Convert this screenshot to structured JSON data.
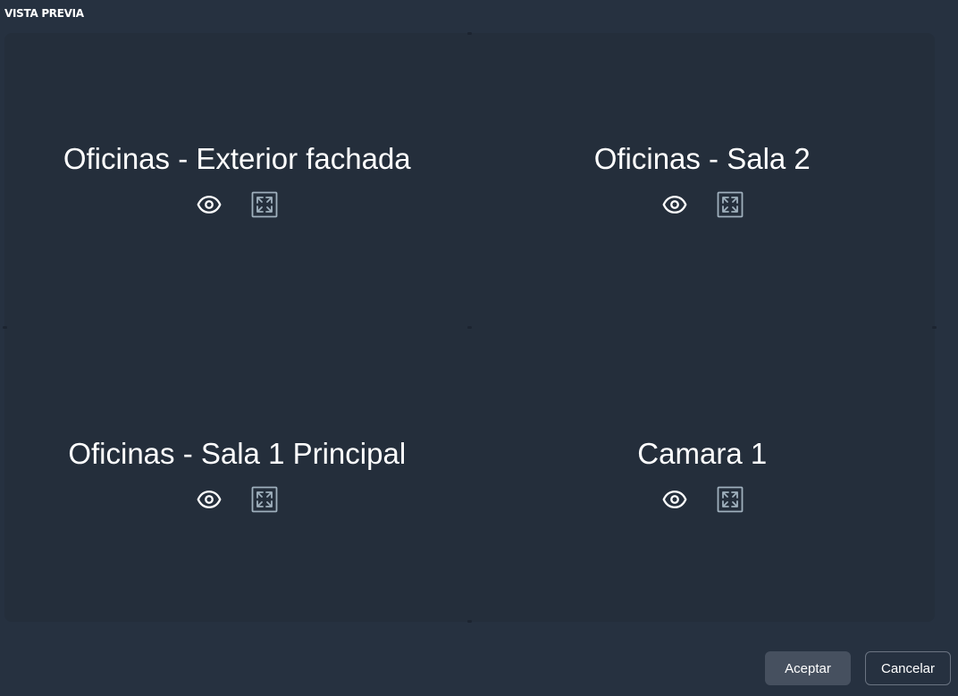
{
  "header": {
    "title": "VISTA PREVIA"
  },
  "cameras": [
    {
      "name": "Oficinas - Exterior fachada",
      "view_icon": "eye-icon",
      "expand_icon": "expand-icon"
    },
    {
      "name": "Oficinas - Sala 2",
      "view_icon": "eye-icon",
      "expand_icon": "expand-icon"
    },
    {
      "name": "Oficinas - Sala 1 Principal",
      "view_icon": "eye-icon",
      "expand_icon": "expand-icon"
    },
    {
      "name": "Camara 1",
      "view_icon": "eye-icon",
      "expand_icon": "expand-icon"
    }
  ],
  "footer": {
    "accept_label": "Aceptar",
    "cancel_label": "Cancelar"
  },
  "colors": {
    "background": "#263140",
    "panel": "#242e3b",
    "text": "#ffffff",
    "icon_expand": "#9fb0bd",
    "accept_bg": "#46505f",
    "cancel_border": "#6b7482"
  }
}
